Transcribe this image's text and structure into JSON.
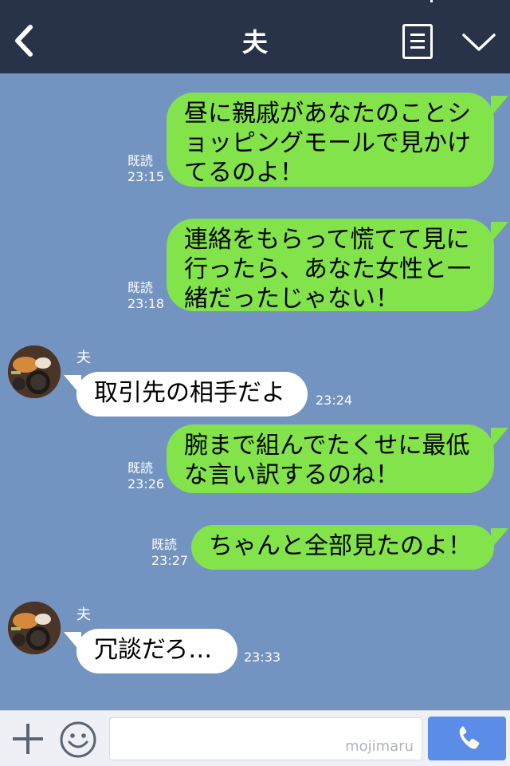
{
  "header": {
    "title": "夫",
    "back_icon": "chevron-left-icon",
    "menu_icon": "notes-icon",
    "expand_icon": "chevron-down-icon"
  },
  "messages": [
    {
      "side": "out",
      "lines": [
        "昼に親戚があなたのことシ",
        "ョッピングモールで見かけ",
        "てるのよ！"
      ],
      "read": "既読",
      "time": "23:15"
    },
    {
      "side": "out",
      "lines": [
        "連絡をもらって慌てて見に",
        "行ったら、あなた女性と一",
        "緒だったじゃない！"
      ],
      "read": "既読",
      "time": "23:18"
    },
    {
      "side": "in",
      "sender": "夫",
      "lines": [
        "取引先の相手だよ"
      ],
      "time": "23:24"
    },
    {
      "side": "out",
      "lines": [
        "腕まで組んでたくせに最低",
        "な言い訳するのね！"
      ],
      "read": "既読",
      "time": "23:26"
    },
    {
      "side": "out",
      "lines": [
        "ちゃんと全部見たのよ！"
      ],
      "read": "既読",
      "time": "23:27"
    },
    {
      "side": "in",
      "sender": "夫",
      "lines": [
        "冗談だろ…"
      ],
      "time": "23:33"
    }
  ],
  "footer": {
    "input_value": "",
    "watermark": "mojimaru",
    "plus_icon": "plus-icon",
    "emoji_icon": "smiley-icon",
    "call_icon": "phone-icon"
  },
  "colors": {
    "header_bg": "#283249",
    "chat_bg": "#7393c0",
    "outgoing_bubble": "#83e34b",
    "incoming_bubble": "#ffffff",
    "call_button": "#5b8ce8"
  }
}
